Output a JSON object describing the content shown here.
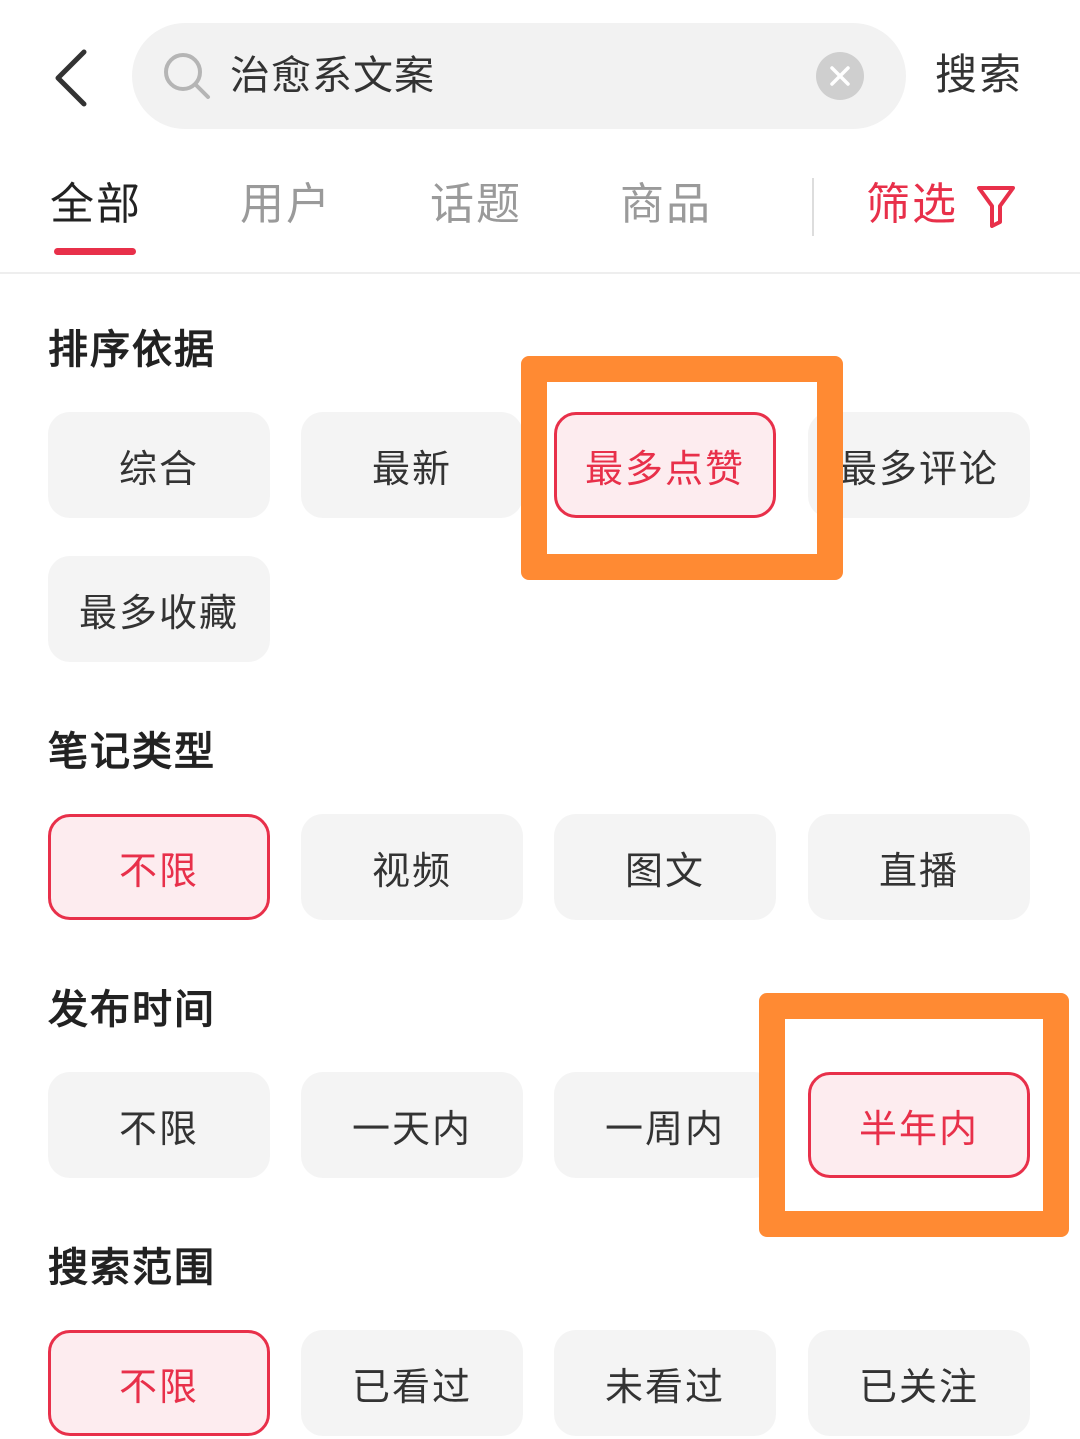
{
  "header": {
    "search_value": "治愈系文案",
    "search_button": "搜索"
  },
  "tabs": {
    "all": "全部",
    "users": "用户",
    "topics": "话题",
    "products": "商品",
    "filter": "筛选"
  },
  "sections": {
    "sort": {
      "title": "排序依据",
      "options": [
        "综合",
        "最新",
        "最多点赞",
        "最多评论",
        "最多收藏"
      ],
      "selected": "最多点赞"
    },
    "note_type": {
      "title": "笔记类型",
      "options": [
        "不限",
        "视频",
        "图文",
        "直播"
      ],
      "selected": "不限"
    },
    "publish_time": {
      "title": "发布时间",
      "options": [
        "不限",
        "一天内",
        "一周内",
        "半年内"
      ],
      "selected": "半年内"
    },
    "search_scope": {
      "title": "搜索范围",
      "options": [
        "不限",
        "已看过",
        "未看过",
        "已关注"
      ],
      "selected": "不限"
    }
  },
  "colors": {
    "accent": "#e8304a",
    "highlight": "#ff8a33",
    "chip_bg": "#f4f4f4",
    "selected_bg": "#fdecef"
  },
  "icons": [
    "back-arrow-icon",
    "search-icon",
    "clear-icon",
    "filter-funnel-icon"
  ]
}
